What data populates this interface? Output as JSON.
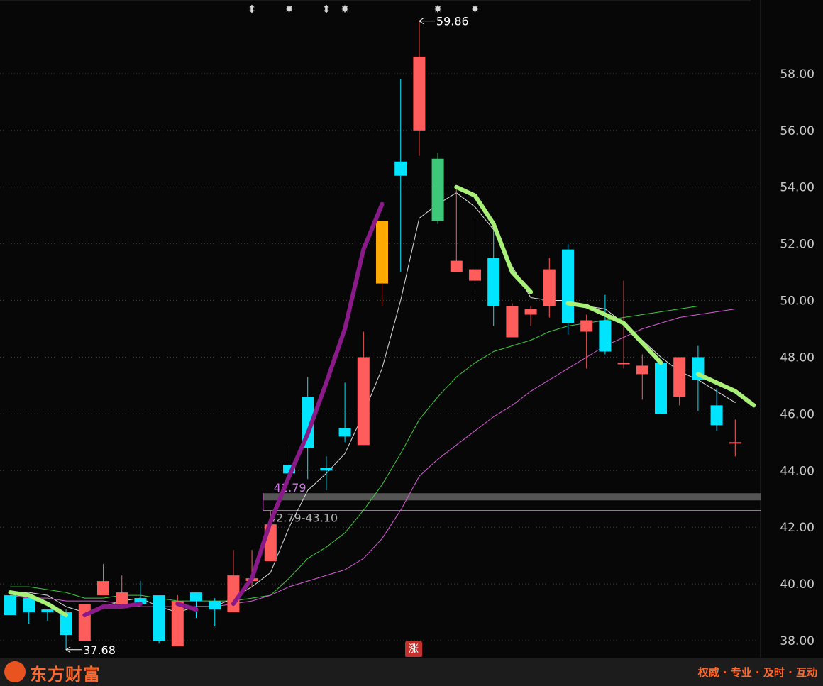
{
  "chart_data": {
    "type": "candlestick",
    "y_axis": {
      "ticks": [
        "38.00",
        "40.00",
        "42.00",
        "44.00",
        "46.00",
        "48.00",
        "50.00",
        "52.00",
        "54.00",
        "56.00",
        "58.00"
      ],
      "range": [
        37.4,
        60.6
      ]
    },
    "candles": [
      {
        "o": 39.6,
        "h": 39.6,
        "l": 38.9,
        "c": 38.9
      },
      {
        "o": 39.5,
        "h": 39.6,
        "l": 38.6,
        "c": 39.0
      },
      {
        "o": 39.1,
        "h": 39.1,
        "l": 38.7,
        "c": 39.0
      },
      {
        "o": 39.0,
        "h": 39.1,
        "l": 37.68,
        "c": 38.2
      },
      {
        "o": 38.0,
        "h": 39.3,
        "l": 38.0,
        "c": 39.3
      },
      {
        "o": 39.6,
        "h": 40.7,
        "l": 39.6,
        "c": 40.1
      },
      {
        "o": 39.3,
        "h": 40.3,
        "l": 39.2,
        "c": 39.7
      },
      {
        "o": 39.5,
        "h": 40.1,
        "l": 39.5,
        "c": 39.3
      },
      {
        "o": 39.6,
        "h": 39.6,
        "l": 37.9,
        "c": 38.0
      },
      {
        "o": 37.8,
        "h": 39.6,
        "l": 37.8,
        "c": 39.4
      },
      {
        "o": 39.7,
        "h": 39.7,
        "l": 38.8,
        "c": 39.4
      },
      {
        "o": 39.4,
        "h": 39.5,
        "l": 38.5,
        "c": 39.1
      },
      {
        "o": 39.0,
        "h": 41.2,
        "l": 39.0,
        "c": 40.3
      },
      {
        "o": 40.1,
        "h": 41.2,
        "l": 39.9,
        "c": 40.2
      },
      {
        "o": 40.8,
        "h": 42.6,
        "l": 40.8,
        "c": 42.1
      },
      {
        "o": 44.2,
        "h": 44.9,
        "l": 43.5,
        "c": 43.9
      },
      {
        "o": 46.6,
        "h": 47.3,
        "l": 43.7,
        "c": 44.8
      },
      {
        "o": 44.1,
        "h": 44.5,
        "l": 43.3,
        "c": 44.0
      },
      {
        "o": 45.5,
        "h": 47.1,
        "l": 45.0,
        "c": 45.2
      },
      {
        "o": 44.9,
        "h": 48.9,
        "l": 44.9,
        "c": 48.0
      },
      {
        "o": 50.6,
        "h": 52.8,
        "l": 49.8,
        "c": 52.8
      },
      {
        "o": 54.9,
        "h": 57.8,
        "l": 51.0,
        "c": 54.4
      },
      {
        "o": 56.0,
        "h": 59.86,
        "l": 55.1,
        "c": 58.6
      },
      {
        "o": 55.0,
        "h": 55.2,
        "l": 52.7,
        "c": 52.8
      },
      {
        "o": 51.0,
        "h": 54.0,
        "l": 51.0,
        "c": 51.4
      },
      {
        "o": 50.7,
        "h": 52.8,
        "l": 50.3,
        "c": 51.1
      },
      {
        "o": 51.5,
        "h": 52.5,
        "l": 49.1,
        "c": 49.8
      },
      {
        "o": 48.7,
        "h": 49.9,
        "l": 48.7,
        "c": 49.8
      },
      {
        "o": 49.5,
        "h": 49.8,
        "l": 49.1,
        "c": 49.7
      },
      {
        "o": 49.8,
        "h": 51.5,
        "l": 49.4,
        "c": 51.1
      },
      {
        "o": 51.8,
        "h": 52.0,
        "l": 48.8,
        "c": 49.2
      },
      {
        "o": 48.9,
        "h": 49.5,
        "l": 47.6,
        "c": 49.3
      },
      {
        "o": 49.3,
        "h": 50.2,
        "l": 48.1,
        "c": 48.2
      },
      {
        "o": 47.8,
        "h": 50.7,
        "l": 47.6,
        "c": 47.8
      },
      {
        "o": 47.4,
        "h": 48.1,
        "l": 46.5,
        "c": 47.7
      },
      {
        "o": 47.8,
        "h": 47.8,
        "l": 46.0,
        "c": 46.0
      },
      {
        "o": 46.6,
        "h": 48.0,
        "l": 46.3,
        "c": 48.0
      },
      {
        "o": 48.0,
        "h": 48.4,
        "l": 46.1,
        "c": 47.2
      },
      {
        "o": 46.3,
        "h": 46.9,
        "l": 45.4,
        "c": 45.6
      },
      {
        "o": 45.0,
        "h": 45.8,
        "l": 44.5,
        "c": 45.0
      }
    ],
    "special_candle_colors": {
      "20": "#ffaa00",
      "23": "#3ec87a"
    },
    "ma_thin_white": [
      39.7,
      39.7,
      39.6,
      39.2,
      39.0,
      39.2,
      39.4,
      39.5,
      39.2,
      39.0,
      39.2,
      39.2,
      39.5,
      39.9,
      40.4,
      42.0,
      43.3,
      43.9,
      44.6,
      46.0,
      47.6,
      50.0,
      52.9,
      53.4,
      53.8,
      53.3,
      52.5,
      51.2,
      50.1,
      50.0,
      50.0,
      49.8,
      49.7,
      49.2,
      48.6,
      48.0,
      47.5,
      47.2,
      46.8,
      46.4
    ],
    "ma_green_thin": [
      39.9,
      39.9,
      39.8,
      39.7,
      39.5,
      39.5,
      39.6,
      39.6,
      39.5,
      39.4,
      39.4,
      39.4,
      39.4,
      39.5,
      39.6,
      40.2,
      40.9,
      41.3,
      41.8,
      42.6,
      43.5,
      44.6,
      45.8,
      46.6,
      47.3,
      47.8,
      48.2,
      48.4,
      48.6,
      48.9,
      49.1,
      49.2,
      49.3,
      49.4,
      49.5,
      49.6,
      49.7,
      49.8,
      49.8,
      49.8
    ],
    "ma_pink_thin": [
      39.6,
      39.5,
      39.5,
      39.4,
      39.4,
      39.4,
      39.3,
      39.2,
      39.2,
      39.2,
      39.2,
      39.2,
      39.3,
      39.4,
      39.6,
      39.9,
      40.1,
      40.3,
      40.5,
      40.9,
      41.6,
      42.6,
      43.8,
      44.4,
      44.9,
      45.4,
      45.9,
      46.3,
      46.8,
      47.2,
      47.6,
      48.0,
      48.4,
      48.7,
      49.0,
      49.2,
      49.4,
      49.5,
      49.6,
      49.7
    ],
    "ma_thick_segments": [
      {
        "color": "#a8f078",
        "start": 0,
        "values": [
          39.7,
          39.6,
          39.3,
          38.9
        ]
      },
      {
        "color": "#8a1a8a",
        "start": 4,
        "values": [
          38.9,
          39.2,
          39.2,
          39.3
        ]
      },
      {
        "color": "#8a1a8a",
        "start": 9,
        "values": [
          39.3,
          39.1
        ]
      },
      {
        "color": "#8a1a8a",
        "start": 12,
        "values": [
          39.3,
          40.2,
          42.2,
          43.8,
          45.3,
          47.1,
          49.0,
          51.8,
          53.4
        ]
      },
      {
        "color": "#a8f078",
        "start": 24,
        "values": [
          54.0,
          53.7,
          52.7,
          51.0,
          50.3
        ]
      },
      {
        "color": "#a8f078",
        "start": 30,
        "values": [
          49.9,
          49.8,
          49.5,
          49.2,
          48.5,
          47.8
        ]
      },
      {
        "color": "#a8f078",
        "start": 37,
        "values": [
          47.4,
          47.1,
          46.8,
          46.3
        ]
      }
    ],
    "high_label": {
      "index": 22,
      "text": "59.86"
    },
    "low_label": {
      "index": 3,
      "text": "37.68"
    },
    "zone": {
      "low": 42.79,
      "high": 43.1,
      "label_top": "42.79",
      "label_range": "42.79-43.10",
      "start_index": 14
    },
    "top_markers": [
      {
        "index": 13,
        "symbol": "⬍"
      },
      {
        "index": 15,
        "symbol": "✸"
      },
      {
        "index": 17,
        "symbol": "⬍"
      },
      {
        "index": 18,
        "symbol": "✸"
      },
      {
        "index": 23,
        "symbol": "✸"
      },
      {
        "index": 25,
        "symbol": "✸"
      }
    ],
    "badge_index": 22,
    "colors": {
      "up": "#ff5c5c",
      "down": "#00e4ff"
    }
  },
  "footer": {
    "logo_text": "东方财富",
    "slogan": "权威 · 专业 · 及时 · 互动"
  },
  "badge_text": "涨"
}
